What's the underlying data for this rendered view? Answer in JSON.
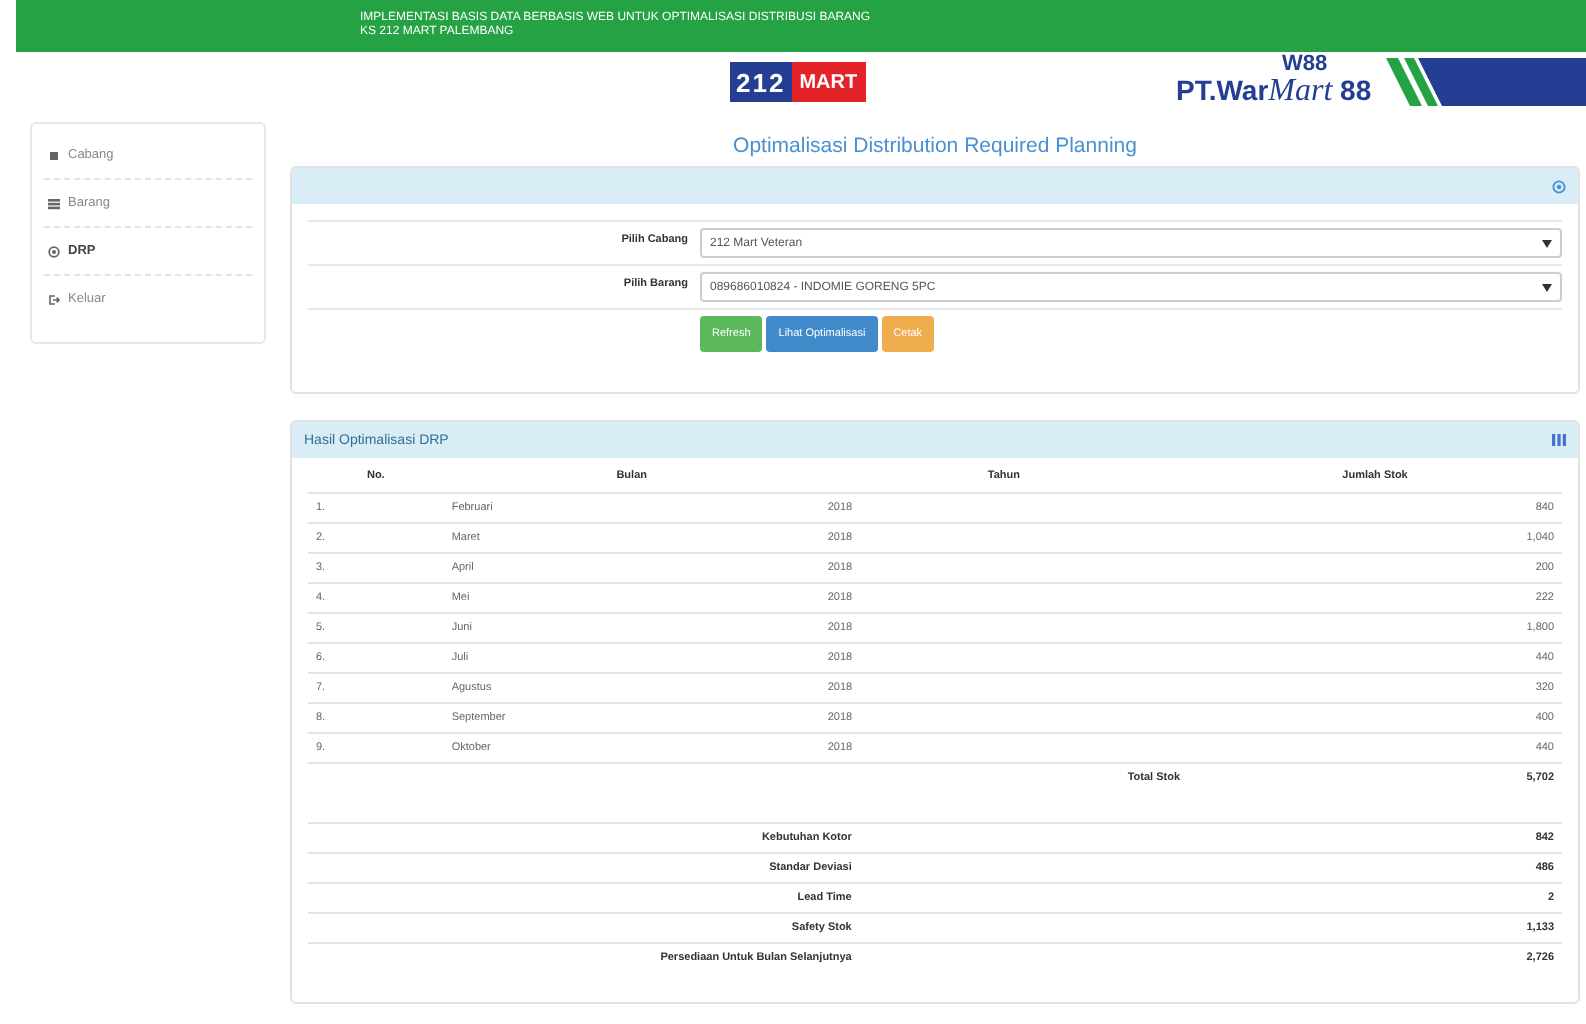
{
  "header": {
    "title_lines": [
      "IMPLEMENTASI BASIS DATA BERBASIS WEB UNTUK OPTIMALISASI DISTRIBUSI BARANG",
      "KS 212 MART PALEMBANG"
    ]
  },
  "logos": {
    "store_number": "212",
    "store_logo": "MART",
    "partner_badge": "W88",
    "partner_name": [
      "PT.War",
      "Mart",
      "88"
    ]
  },
  "sidebar": {
    "items": [
      {
        "label": "Cabang",
        "selected": false
      },
      {
        "label": "Barang",
        "selected": false
      },
      {
        "label": "DRP",
        "selected": true
      },
      {
        "label": "Keluar",
        "selected": false
      }
    ]
  },
  "page_title": "Optimalisasi Distribution Required Planning",
  "form": {
    "fields": [
      {
        "label": "Pilih Cabang",
        "value": "212 Mart Veteran"
      },
      {
        "label": "Pilih Barang",
        "value": "089686010824 - INDOMIE GORENG 5PC"
      }
    ],
    "buttons": [
      {
        "label": "Refresh",
        "kind": "success"
      },
      {
        "label": "Lihat Optimalisasi",
        "kind": "primary"
      },
      {
        "label": "Cetak",
        "kind": "warning"
      }
    ]
  },
  "results": {
    "title": "Hasil Optimalisasi DRP",
    "columns": [
      "No.",
      "Bulan",
      "Tahun",
      "Jumlah Stok"
    ],
    "rows": [
      [
        "1.",
        "Februari",
        "2018",
        "840"
      ],
      [
        "2.",
        "Maret",
        "2018",
        "1,040"
      ],
      [
        "3.",
        "April",
        "2018",
        "200"
      ],
      [
        "4.",
        "Mei",
        "2018",
        "222"
      ],
      [
        "5.",
        "Juni",
        "2018",
        "1,800"
      ],
      [
        "6.",
        "Juli",
        "2018",
        "440"
      ],
      [
        "7.",
        "Agustus",
        "2018",
        "320"
      ],
      [
        "8.",
        "September",
        "2018",
        "400"
      ],
      [
        "9.",
        "Oktober",
        "2018",
        "440"
      ]
    ],
    "total": {
      "label": "Total Stok",
      "value": "5,702"
    },
    "summary": [
      {
        "label": "Kebutuhan Kotor",
        "value": "842"
      },
      {
        "label": "Standar Deviasi",
        "value": "486"
      },
      {
        "label": "Lead Time",
        "value": "2"
      },
      {
        "label": "Safety Stok",
        "value": "1,133"
      },
      {
        "label": "Persediaan Untuk Bulan Selanjutnya",
        "value": "2,726"
      }
    ]
  }
}
